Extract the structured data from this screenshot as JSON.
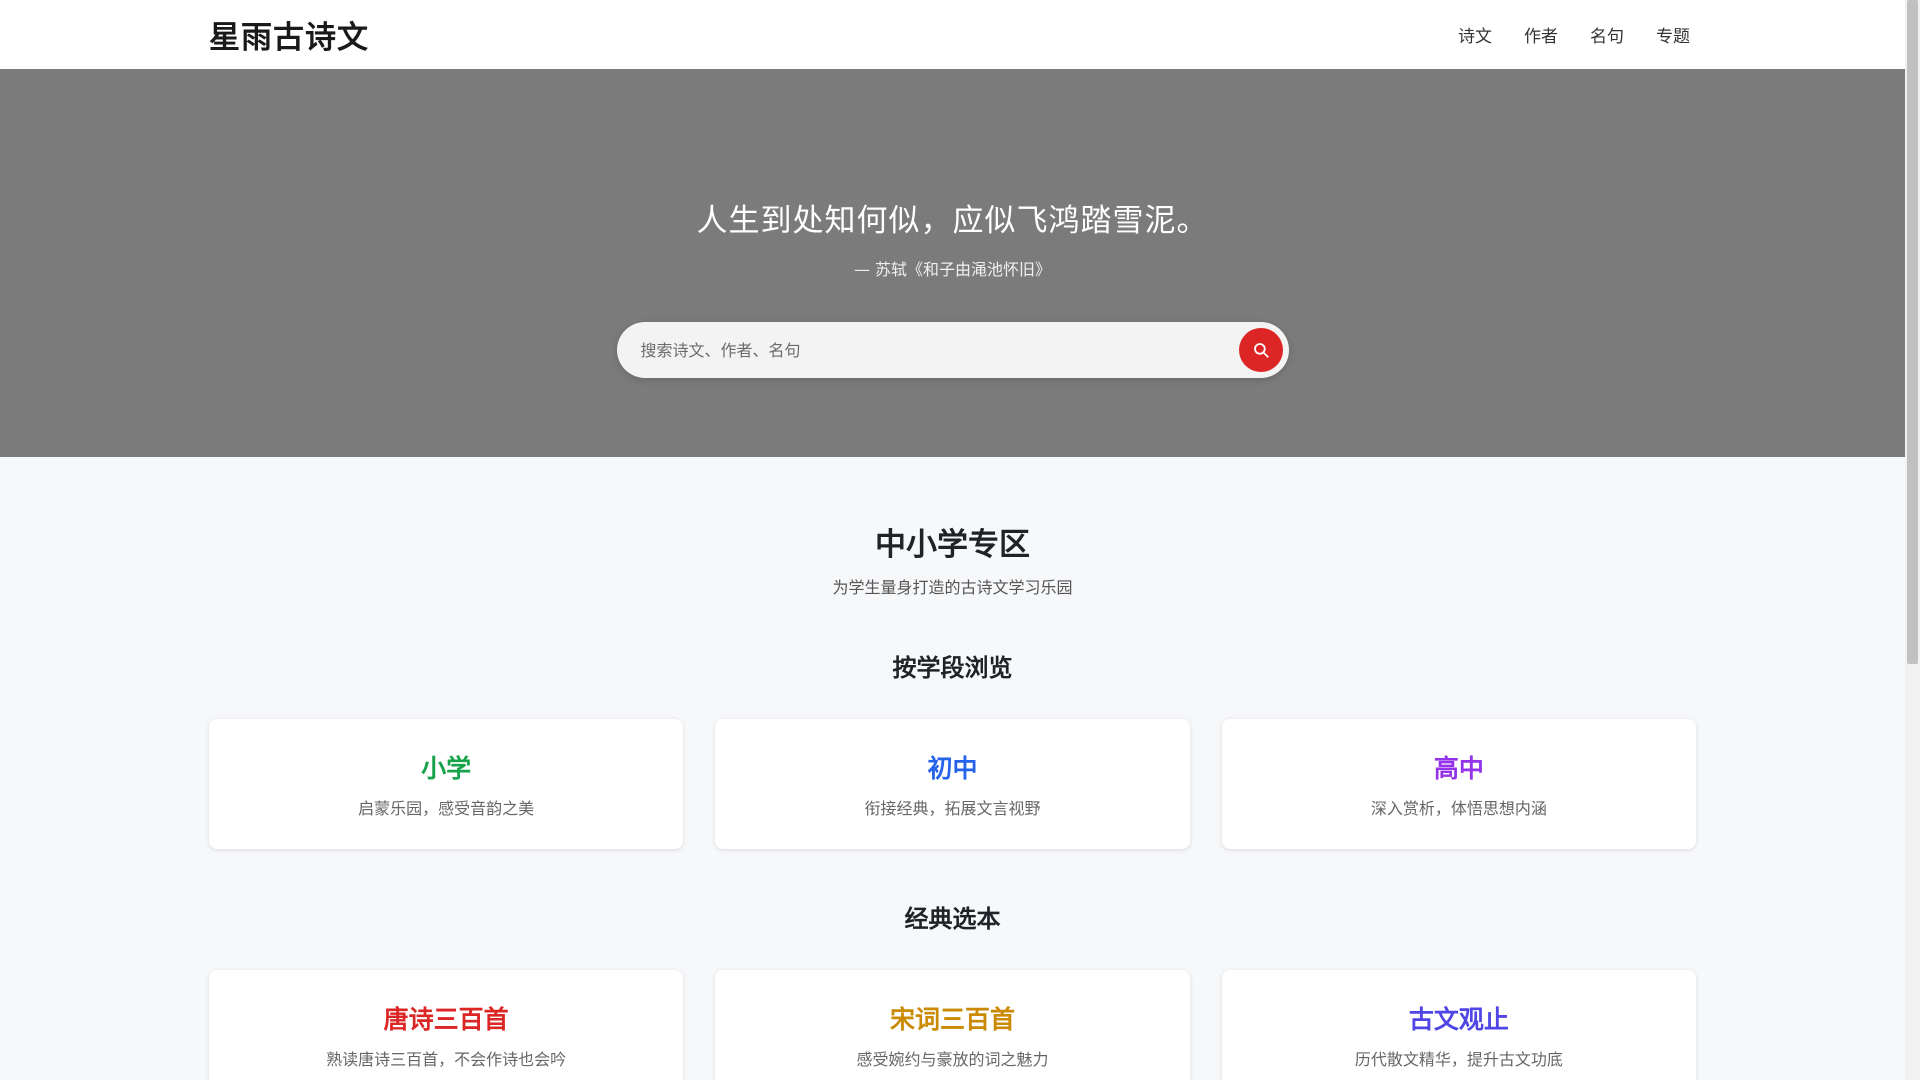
{
  "header": {
    "logo": "星雨古诗文",
    "nav": [
      "诗文",
      "作者",
      "名句",
      "专题"
    ]
  },
  "hero": {
    "quote": "人生到处知何似，应似飞鸿踏雪泥。",
    "source": "— 苏轼《和子由渑池怀旧》",
    "search": {
      "placeholder": "搜索诗文、作者、名句",
      "value": ""
    },
    "icons": {
      "search_button": "search-icon"
    }
  },
  "main": {
    "title": "中小学专区",
    "subtitle": "为学生量身打造的古诗文学习乐园",
    "grade_section": {
      "title": "按学段浏览",
      "cards": [
        {
          "title": "小学",
          "desc": "启蒙乐园，感受音韵之美",
          "color": "#16a34a"
        },
        {
          "title": "初中",
          "desc": "衔接经典，拓展文言视野",
          "color": "#2563eb"
        },
        {
          "title": "高中",
          "desc": "深入赏析，体悟思想内涵",
          "color": "#9333ea"
        }
      ]
    },
    "classic_section": {
      "title": "经典选本",
      "cards": [
        {
          "title": "唐诗三百首",
          "desc": "熟读唐诗三百首，不会作诗也会吟",
          "color": "#dc2626"
        },
        {
          "title": "宋词三百首",
          "desc": "感受婉约与豪放的词之魅力",
          "color": "#ca8a04"
        },
        {
          "title": "古文观止",
          "desc": "历代散文精华，提升古文功底",
          "color": "#4f46e5"
        }
      ]
    }
  },
  "colors": {
    "accent": "#dc2626",
    "hero_bg": "#7b7b7b"
  }
}
